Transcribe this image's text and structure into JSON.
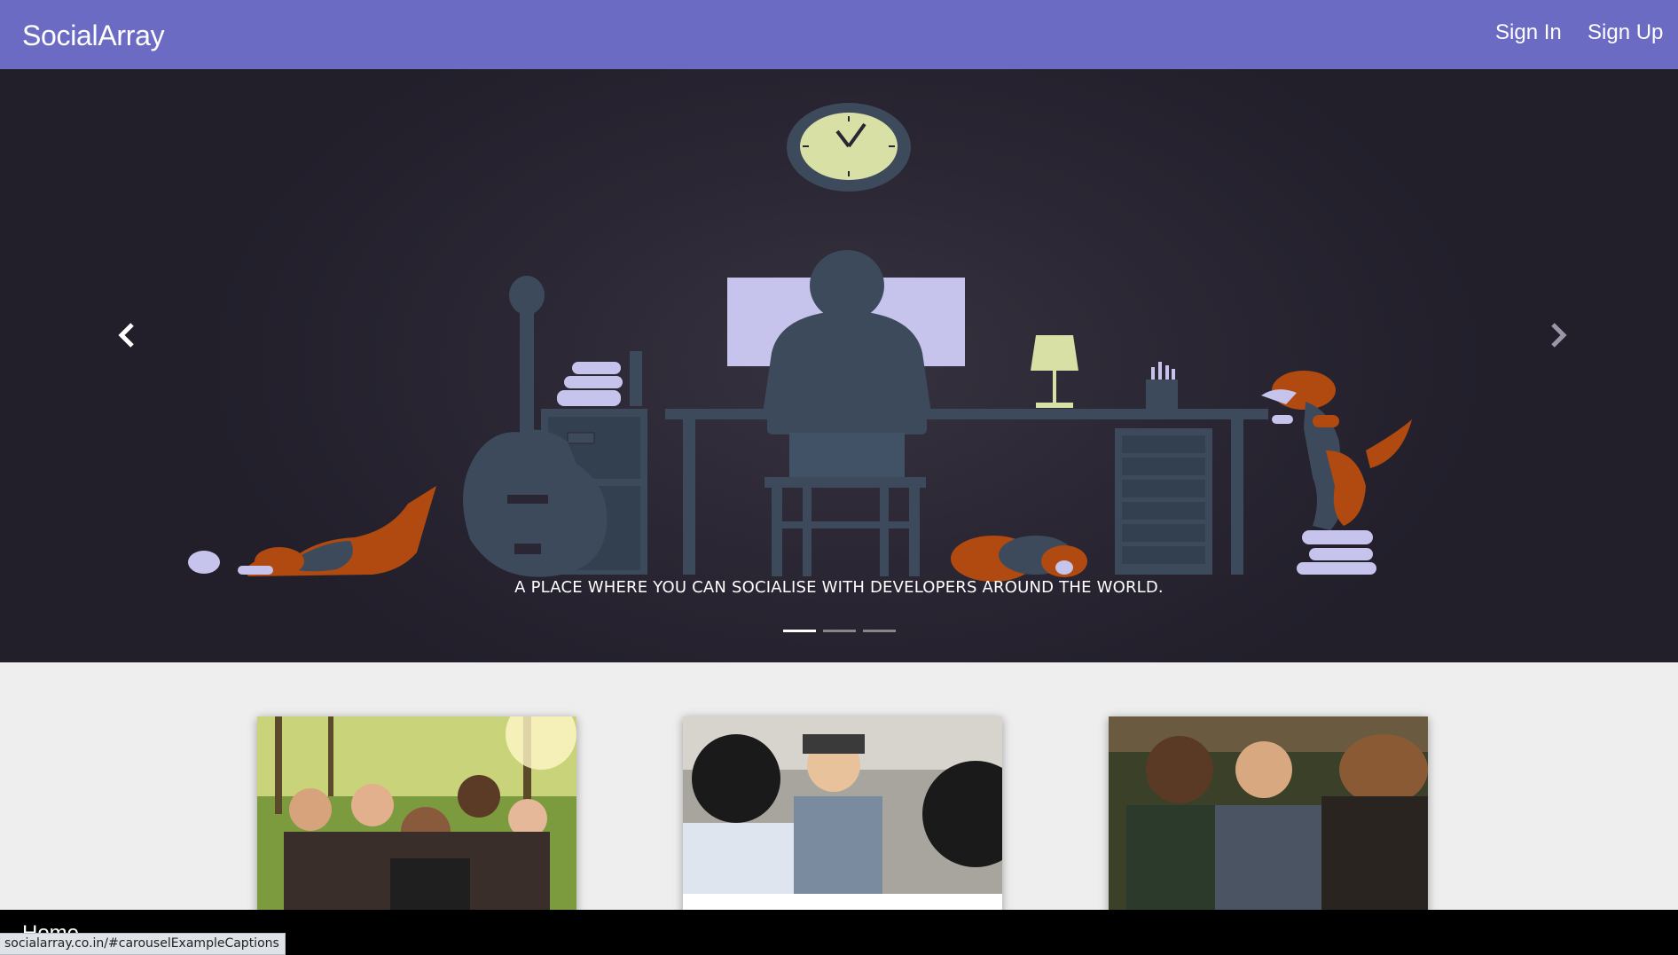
{
  "navbar": {
    "brand": "SocialArray",
    "sign_in": "Sign In",
    "sign_up": "Sign Up",
    "background": "#6b6bc4"
  },
  "carousel": {
    "caption": "A PLACE WHERE YOU CAN SOCIALISE WITH DEVELOPERS AROUND THE WORLD.",
    "prev_icon": "chevron-left-icon",
    "next_icon": "chevron-right-icon",
    "indicators": [
      "slide-1",
      "slide-2",
      "slide-3"
    ],
    "active_index": 0
  },
  "cards": [
    {
      "image": "group-selfie-photo"
    },
    {
      "image": "smiling-friends-photo"
    },
    {
      "image": "men-talking-photo"
    }
  ],
  "footer": {
    "home_label": "Home"
  },
  "status_bar": {
    "url": "socialarray.co.in/#carouselExampleCaptions"
  }
}
